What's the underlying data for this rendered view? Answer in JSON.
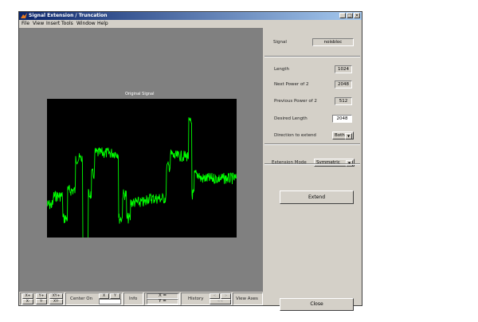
{
  "window": {
    "title": "Signal Extension / Truncation"
  },
  "menu": [
    "File",
    "View",
    "Insert",
    "Tools",
    "Window",
    "Help"
  ],
  "plot": {
    "title": "Original Signal"
  },
  "panel": {
    "signal_label": "Signal",
    "signal_value": "noisbloc",
    "length_label": "Length",
    "length_value": "1024",
    "next_pow_label": "Next Power of 2",
    "next_pow_value": "2048",
    "prev_pow_label": "Previous Power of 2",
    "prev_pow_value": "512",
    "desired_label": "Desired Length",
    "desired_value": "2048",
    "direction_label": "Direction to extend",
    "direction_value": "Both",
    "mode_label": "Extension Mode",
    "mode_value": "Symmetric",
    "extend_button": "Extend",
    "close_button": "Close"
  },
  "toolbar": {
    "xplus": "X+",
    "yplus": "Y+",
    "xyplus": "XY+",
    "xminus": "X-",
    "yminus": "Y-",
    "xyminus": "XY-",
    "center_on": "Center On",
    "cx": "X",
    "cy": "Y",
    "info": "Info",
    "xeq": "X =",
    "yeq": "Y =",
    "history": "History",
    "h_left": "<",
    "h_right": ">",
    "h_back": "<<",
    "view_axes": "View Axes"
  }
}
